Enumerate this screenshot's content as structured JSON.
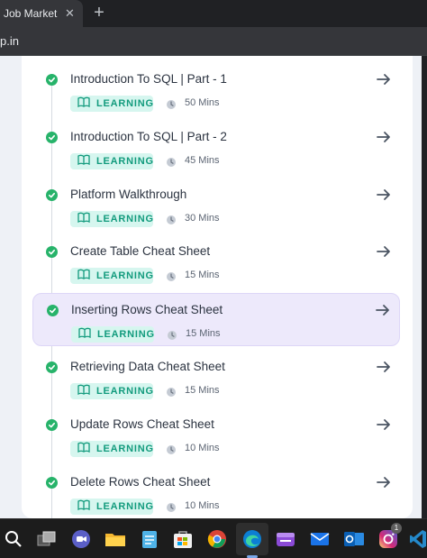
{
  "browser": {
    "tab_title": "Job Market | N",
    "tab_close": "✕",
    "new_tab": "+",
    "url_fragment": "p.in"
  },
  "lessons": [
    {
      "title": "Introduction To SQL | Part - 1",
      "badge": "LEARNING",
      "duration": "50 Mins",
      "active": false
    },
    {
      "title": "Introduction To SQL | Part - 2",
      "badge": "LEARNING",
      "duration": "45 Mins",
      "active": false
    },
    {
      "title": "Platform Walkthrough",
      "badge": "LEARNING",
      "duration": "30 Mins",
      "active": false
    },
    {
      "title": "Create Table Cheat Sheet",
      "badge": "LEARNING",
      "duration": "15 Mins",
      "active": false
    },
    {
      "title": "Inserting Rows Cheat Sheet",
      "badge": "LEARNING",
      "duration": "15 Mins",
      "active": true
    },
    {
      "title": "Retrieving Data Cheat Sheet",
      "badge": "LEARNING",
      "duration": "15 Mins",
      "active": false
    },
    {
      "title": "Update Rows Cheat Sheet",
      "badge": "LEARNING",
      "duration": "10 Mins",
      "active": false
    },
    {
      "title": "Delete Rows Cheat Sheet",
      "badge": "LEARNING",
      "duration": "10 Mins",
      "active": false
    }
  ],
  "taskbar": {
    "instagram_badge": "1",
    "icons": [
      "search-icon",
      "task-view-icon",
      "chat-icon",
      "file-explorer-icon",
      "notepad-icon",
      "store-icon",
      "chrome-icon",
      "edge-icon",
      "media-icon",
      "mail-icon",
      "outlook-icon",
      "instagram-icon",
      "vscode-icon"
    ]
  },
  "colors": {
    "check": "#27b36a",
    "badge_bg": "#d6f6ef",
    "badge_text": "#129b7d",
    "active_row": "#ede9fb"
  }
}
